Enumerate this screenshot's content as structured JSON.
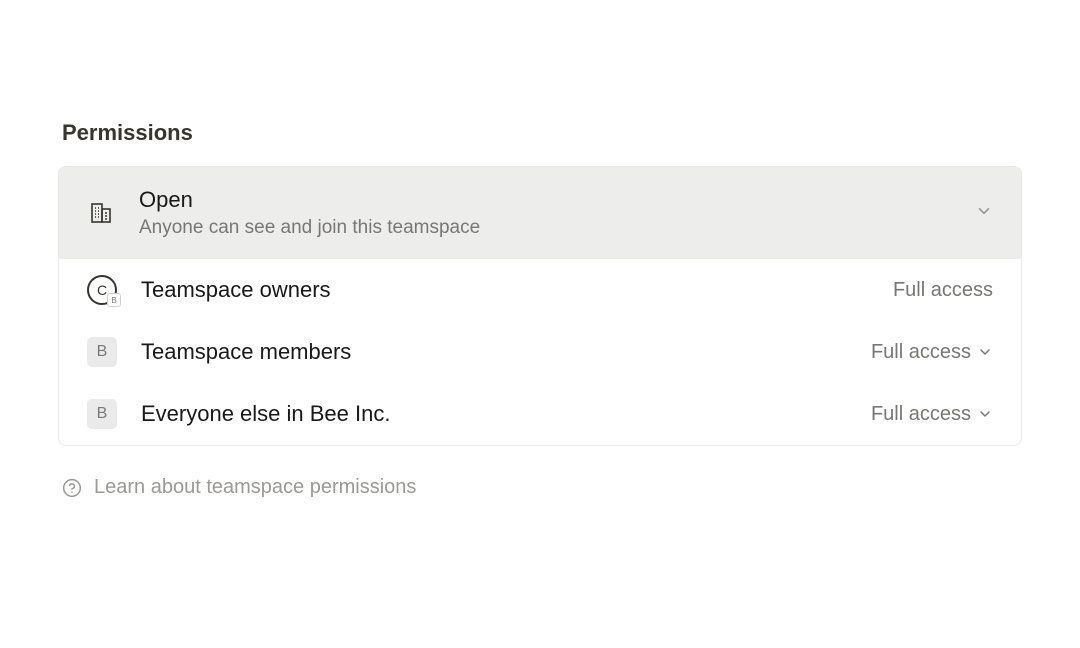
{
  "section": {
    "heading": "Permissions"
  },
  "accessLevel": {
    "title": "Open",
    "subtitle": "Anyone can see and join this teamspace"
  },
  "roles": [
    {
      "label": "Teamspace owners",
      "access": "Full access",
      "iconType": "circle",
      "iconLetter": "C",
      "subBadge": "B",
      "editable": false
    },
    {
      "label": "Teamspace members",
      "access": "Full access",
      "iconType": "square",
      "iconLetter": "B",
      "editable": true
    },
    {
      "label": "Everyone else in Bee Inc.",
      "access": "Full access",
      "iconType": "square",
      "iconLetter": "B",
      "editable": true
    }
  ],
  "helpLink": {
    "label": "Learn about teamspace permissions"
  }
}
